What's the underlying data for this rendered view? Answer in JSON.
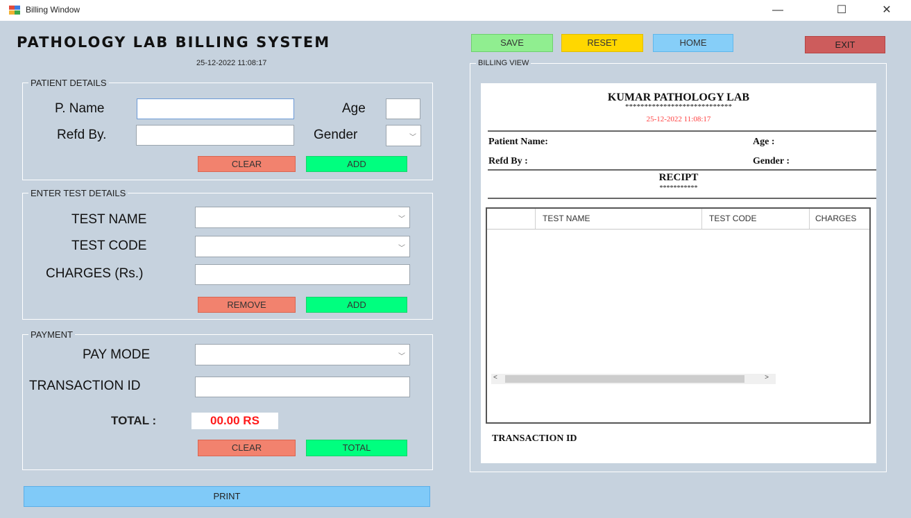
{
  "window": {
    "title": "Billing Window",
    "minimize": "—",
    "maximize": "☐",
    "close": "✕"
  },
  "header": {
    "title": "PATHOLOGY LAB BILLING SYSTEM",
    "datetime": "25-12-2022 11:08:17"
  },
  "patient": {
    "group_label": "PATIENT DETAILS",
    "name_label": "P. Name",
    "name_value": "",
    "refd_label": "Refd By.",
    "refd_value": "",
    "age_label": "Age",
    "age_value": "",
    "gender_label": "Gender",
    "gender_value": "",
    "clear_label": "CLEAR",
    "add_label": "ADD"
  },
  "test": {
    "group_label": "ENTER TEST DETAILS",
    "name_label": "TEST NAME",
    "name_value": "",
    "code_label": "TEST CODE",
    "code_value": "",
    "charges_label": "CHARGES (Rs.)",
    "charges_value": "",
    "remove_label": "REMOVE",
    "add_label": "ADD"
  },
  "payment": {
    "group_label": "PAYMENT",
    "mode_label": "PAY MODE",
    "mode_value": "",
    "txn_label": "TRANSACTION ID",
    "txn_value": "",
    "total_label": "TOTAL :",
    "total_value": "00.00 RS",
    "clear_label": "CLEAR",
    "total_button_label": "TOTAL"
  },
  "print_label": "PRINT",
  "toolbar": {
    "save": "SAVE",
    "reset": "RESET",
    "home": "HOME",
    "exit": "EXIT"
  },
  "billing_view": {
    "group_label": "BILLING VIEW",
    "lab_name": "KUMAR PATHOLOGY LAB",
    "stars_top": "****************************",
    "datetime": "25-12-2022 11:08:17",
    "patient_name_label": "Patient Name:",
    "age_label": "Age :",
    "refd_label": "Refd By :",
    "gender_label": "Gender :",
    "receipt_label": "RECIPT",
    "stars_bottom": "***********",
    "columns": [
      "",
      "TEST NAME",
      "TEST CODE",
      "CHARGES"
    ],
    "scroll_left": "<",
    "scroll_right": ">",
    "transaction_label": "TRANSACTION ID"
  },
  "colors": {
    "background": "#c6d2de",
    "save": "#90ee90",
    "reset": "#ffd700",
    "home": "#86cef8",
    "exit": "#cd5c5c",
    "clear": "#f2826e",
    "add": "#00ff7f",
    "total_text": "#ff1a1a",
    "print": "#80caf8"
  }
}
